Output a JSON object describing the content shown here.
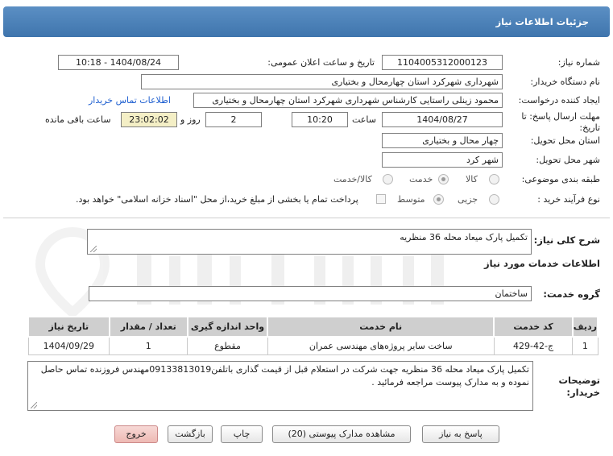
{
  "header": {
    "title": "جزئیات اطلاعات نیاز"
  },
  "form": {
    "need_number": {
      "label": "شماره نیاز:",
      "value": "1104005312000123"
    },
    "announce_datetime": {
      "label": "تاریخ و ساعت اعلان عمومی:",
      "value": "1404/08/24 - 10:18"
    },
    "buyer_org": {
      "label": "نام دستگاه خریدار:",
      "value": "شهرداری شهرکرد استان چهارمحال و بختیاری"
    },
    "requester": {
      "label": "ایجاد کننده درخواست:",
      "value": "محمود زینلی راستایی کارشناس شهرداری شهرکرد استان چهارمحال و بختیاری",
      "contact_link": "اطلاعات تماس خریدار"
    },
    "deadline": {
      "label_line1": "مهلت ارسال پاسخ: تا",
      "label_line2": "تاریخ:",
      "date": "1404/08/27",
      "time_label": "ساعت",
      "time": "10:20",
      "days": "2",
      "days_label": "روز و",
      "remaining": "23:02:02",
      "remaining_label": "ساعت باقی مانده"
    },
    "province": {
      "label": "استان محل تحویل:",
      "value": "چهار محال و بختیاری"
    },
    "city": {
      "label": "شهر محل تحویل:",
      "value": "شهر کرد"
    },
    "category": {
      "label": "طبقه بندی موضوعی:",
      "options": [
        "کالا",
        "خدمت",
        "کالا/خدمت"
      ],
      "selected": 1
    },
    "process": {
      "label": "نوع فرآیند خرید :",
      "options": [
        "جزیی",
        "متوسط"
      ],
      "selected": 0,
      "checkbox_label": "پرداخت تمام یا بخشی از مبلغ خرید،از محل \"اسناد خزانه اسلامی\" خواهد بود."
    }
  },
  "summary": {
    "label": "شرح کلی نیاز:",
    "value": "تکمیل پارک میعاد محله 36 منظریه"
  },
  "services": {
    "section_title": "اطلاعات خدمات مورد نیاز",
    "group_label": "گروه خدمت:",
    "group_value": "ساختمان",
    "columns": [
      "ردیف",
      "کد خدمت",
      "نام خدمت",
      "واحد اندازه گیری",
      "تعداد / مقدار",
      "تاریخ نیاز"
    ],
    "rows": [
      [
        "1",
        "ج-42-429",
        "ساخت سایر پروژه‌های مهندسی عمران",
        "مقطوع",
        "1",
        "1404/09/29"
      ]
    ]
  },
  "buyer_notes": {
    "label_line1": "توضیحات",
    "label_line2": "خریدار:",
    "value": "تکمیل پارک میعاد محله 36 منظریه جهت شرکت در استعلام قبل از قیمت گذاری باتلفن09133813019مهندس فروزنده تماس حاصل نموده و به مدارک پیوست مراجعه فرمائید ."
  },
  "buttons": {
    "reply": "پاسخ به نیاز",
    "attachments": "مشاهده مدارک پیوستی (20)",
    "print": "چاپ",
    "back": "بازگشت",
    "exit": "خروج"
  },
  "colors": {
    "title_bar": "#4a80b8",
    "link": "#1e5fd0",
    "highlight_field": "#f4efc6",
    "table_header": "#cfcfcf",
    "exit_button": "#eeb9b3"
  }
}
